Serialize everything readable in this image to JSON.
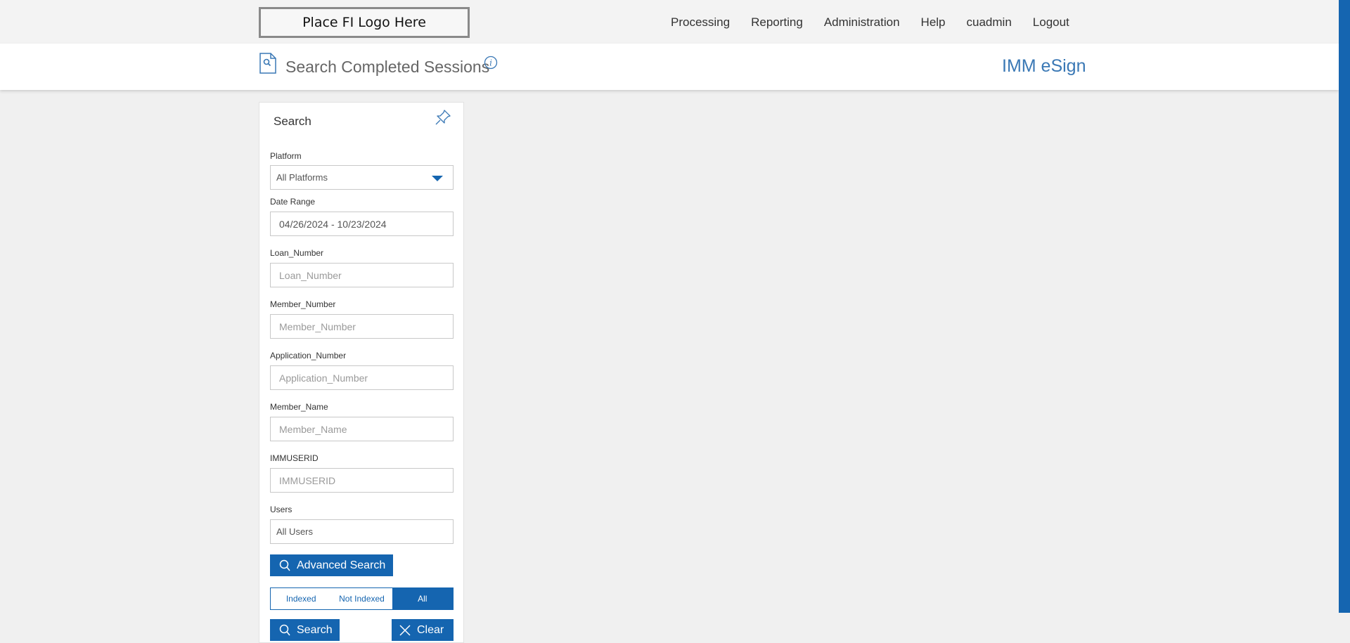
{
  "header": {
    "logo_text": "Place FI Logo Here",
    "nav": [
      "Processing",
      "Reporting",
      "Administration",
      "Help",
      "cuadmin",
      "Logout"
    ]
  },
  "titlebar": {
    "title": "Search Completed Sessions",
    "app_name": "IMM eSign"
  },
  "search_panel": {
    "title": "Search",
    "platform": {
      "label": "Platform",
      "value": "All Platforms"
    },
    "date_range": {
      "label": "Date Range",
      "value": "04/26/2024 - 10/23/2024"
    },
    "loan_number": {
      "label": "Loan_Number",
      "placeholder": "Loan_Number"
    },
    "member_number": {
      "label": "Member_Number",
      "placeholder": "Member_Number"
    },
    "application_number": {
      "label": "Application_Number",
      "placeholder": "Application_Number"
    },
    "member_name": {
      "label": "Member_Name",
      "placeholder": "Member_Name"
    },
    "immuserid": {
      "label": "IMMUSERID",
      "placeholder": "IMMUSERID"
    },
    "users": {
      "label": "Users",
      "value": "All Users"
    },
    "advanced_search_label": "Advanced Search",
    "index_filter": {
      "options": [
        "Indexed",
        "Not Indexed",
        "All"
      ],
      "selected": "All"
    },
    "search_label": "Search",
    "clear_label": "Clear"
  },
  "colors": {
    "accent": "#1565b0",
    "app_name": "#3a78b5"
  }
}
